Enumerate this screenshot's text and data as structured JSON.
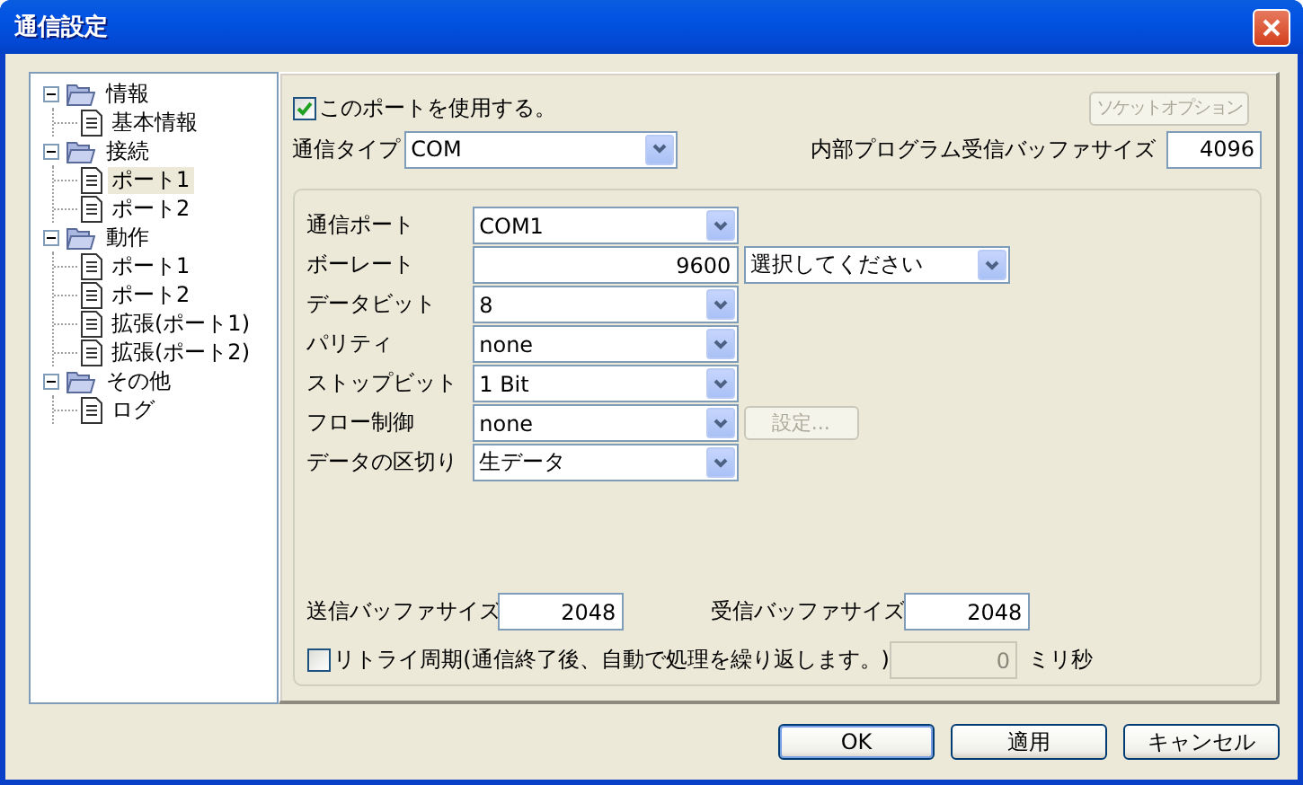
{
  "window": {
    "title": "通信設定"
  },
  "tree": [
    {
      "label": "情報",
      "expanded": true,
      "children": [
        {
          "label": "基本情報",
          "selected": false
        }
      ]
    },
    {
      "label": "接続",
      "expanded": true,
      "children": [
        {
          "label": "ポート1",
          "selected": true
        },
        {
          "label": "ポート2",
          "selected": false
        }
      ]
    },
    {
      "label": "動作",
      "expanded": true,
      "children": [
        {
          "label": "ポート1",
          "selected": false
        },
        {
          "label": "ポート2",
          "selected": false
        },
        {
          "label": "拡張(ポート1)",
          "selected": false
        },
        {
          "label": "拡張(ポート2)",
          "selected": false
        }
      ]
    },
    {
      "label": "その他",
      "expanded": true,
      "children": [
        {
          "label": "ログ",
          "selected": false
        }
      ]
    }
  ],
  "use_port": {
    "label": "このポートを使用する。",
    "checked": true
  },
  "socket_option_button": {
    "label": "ソケットオプション",
    "disabled": true
  },
  "comm_type": {
    "label": "通信タイプ",
    "value": "COM"
  },
  "internal_buffer": {
    "label": "内部プログラム受信バッファサイズ",
    "value": "4096"
  },
  "settings": [
    {
      "kind": "select",
      "label": "通信ポート",
      "value": "COM1"
    },
    {
      "kind": "number_select",
      "label": "ボーレート",
      "value": "9600",
      "option": "選択してください"
    },
    {
      "kind": "select",
      "label": "データビット",
      "value": "8"
    },
    {
      "kind": "select",
      "label": "パリティ",
      "value": "none"
    },
    {
      "kind": "select",
      "label": "ストップビット",
      "value": "1 Bit"
    },
    {
      "kind": "select_button",
      "label": "フロー制御",
      "value": "none",
      "button": "設定...",
      "button_disabled": true
    },
    {
      "kind": "select",
      "label": "データの区切り",
      "value": "生データ"
    }
  ],
  "send_buffer": {
    "label": "送信バッファサイズ",
    "value": "2048"
  },
  "receive_buffer": {
    "label": "受信バッファサイズ",
    "value": "2048"
  },
  "retry": {
    "label": "リトライ周期(通信終了後、自動で処理を繰り返します。)",
    "checked": false,
    "value": "0",
    "unit": "ミリ秒"
  },
  "buttons": [
    {
      "label": "OK",
      "default": true
    },
    {
      "label": "適用",
      "default": false
    },
    {
      "label": "キャンセル",
      "default": false
    }
  ]
}
